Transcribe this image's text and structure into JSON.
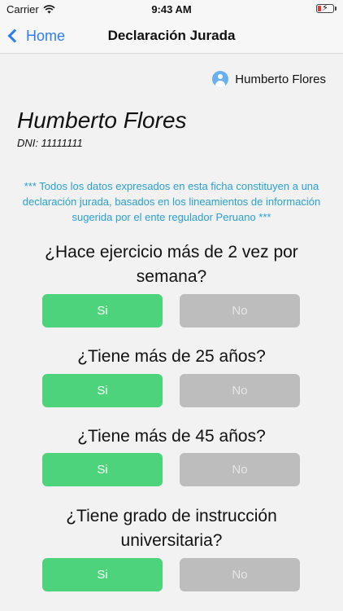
{
  "status_bar": {
    "carrier": "Carrier",
    "time": "9:43 AM"
  },
  "nav": {
    "back_label": "Home",
    "title": "Declaración Jurada"
  },
  "user": {
    "chip_name": "Humberto Flores",
    "name": "Humberto Flores",
    "dni": "DNI: 11111111"
  },
  "disclaimer": "*** Todos los datos expresados en esta ficha constituyen a una declaración jurada, basados en los lineamientos de información sugerida por el ente regulador Peruano ***",
  "questions": [
    {
      "text": "¿Hace ejercicio más de 2 vez por semana?",
      "yes_label": "Si",
      "no_label": "No"
    },
    {
      "text": "¿Tiene más de 25 años?",
      "yes_label": "Si",
      "no_label": "No"
    },
    {
      "text": "¿Tiene más de 45 años?",
      "yes_label": "Si",
      "no_label": "No"
    },
    {
      "text": "¿Tiene grado de instrucción universitaria?",
      "yes_label": "Si",
      "no_label": "No"
    }
  ],
  "colors": {
    "accent": "#2f7cf6",
    "yes": "#4cd37b",
    "no": "#bdbdbd",
    "disclaimer": "#2aa0d4"
  }
}
